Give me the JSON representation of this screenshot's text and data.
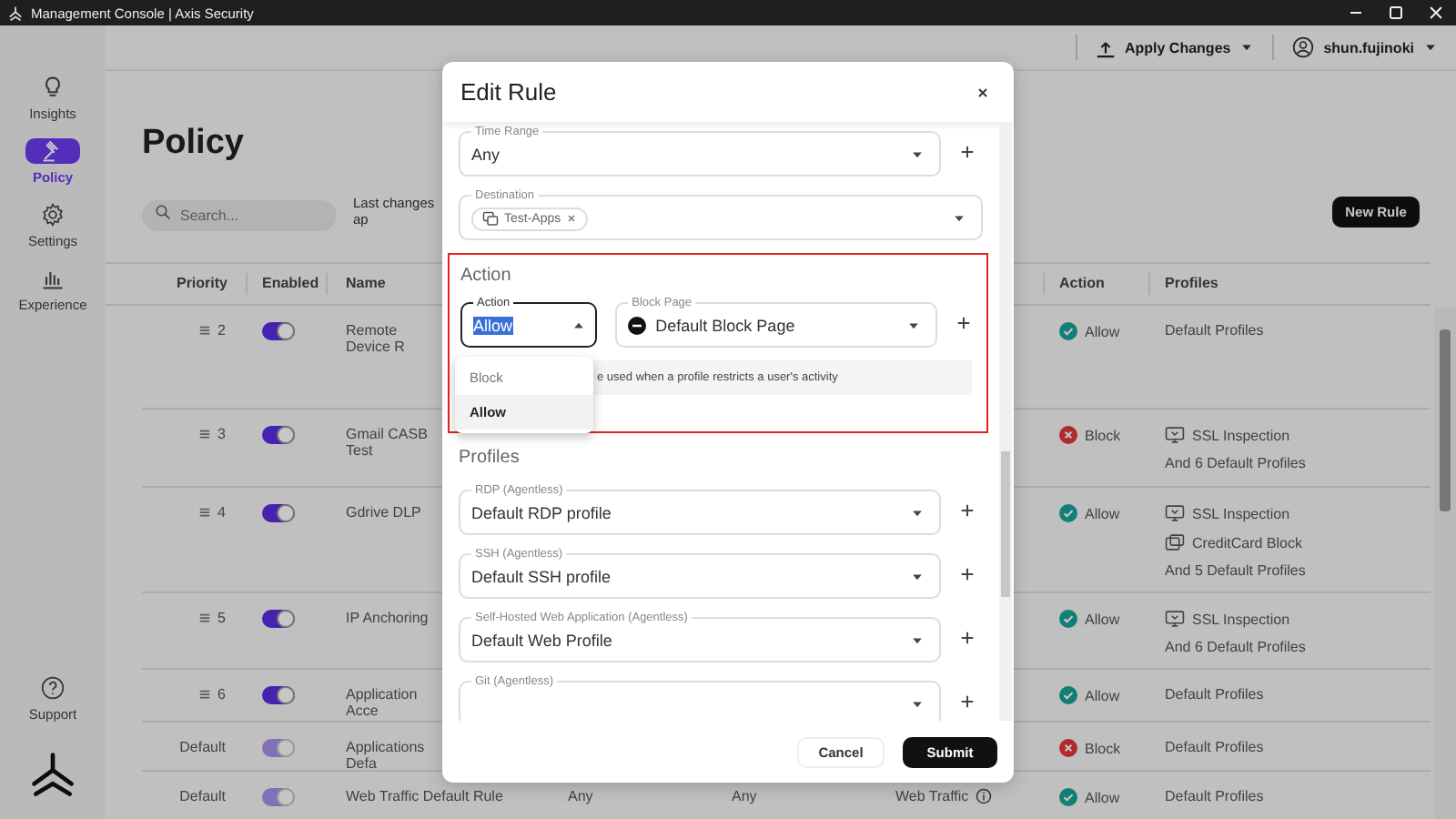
{
  "window": {
    "title": "Management Console | Axis Security"
  },
  "sidebar": {
    "items": [
      {
        "label": "Insights",
        "kind": "bulb",
        "selected": false
      },
      {
        "label": "Policy",
        "kind": "gavel",
        "selected": true
      },
      {
        "label": "Settings",
        "kind": "gear",
        "selected": false
      },
      {
        "label": "Experience",
        "kind": "chart",
        "selected": false
      }
    ],
    "support": "Support"
  },
  "topbar": {
    "apply_changes": "Apply Changes",
    "user": "shun.fujinoki"
  },
  "page": {
    "title": "Policy",
    "search": {
      "placeholder": "Search..."
    },
    "last_changes": "Last changes ap",
    "new_rule": "New Rule"
  },
  "table": {
    "columns": [
      "Priority",
      "Enabled",
      "Name",
      "Action",
      "Profiles"
    ],
    "rows": [
      {
        "priority": "2",
        "draggable": true,
        "enabled": {
          "on": true,
          "disabled": false
        },
        "name": "Remote Device R",
        "action": {
          "kind": "allow",
          "label": "Allow"
        },
        "profiles": [
          {
            "kind": "text",
            "label": "Default Profiles"
          }
        ]
      },
      {
        "priority": "3",
        "draggable": true,
        "enabled": {
          "on": true,
          "disabled": false
        },
        "name": "Gmail CASB Test",
        "action": {
          "kind": "block",
          "label": "Block"
        },
        "profiles": [
          {
            "kind": "ssl",
            "label": "SSL Inspection"
          },
          {
            "kind": "text",
            "label": "And 6 Default Profiles"
          }
        ]
      },
      {
        "priority": "4",
        "draggable": true,
        "enabled": {
          "on": true,
          "disabled": false
        },
        "name": "Gdrive DLP",
        "action": {
          "kind": "allow",
          "label": "Allow"
        },
        "profiles": [
          {
            "kind": "ssl",
            "label": "SSL Inspection"
          },
          {
            "kind": "dlp",
            "label": "CreditCard Block"
          },
          {
            "kind": "text",
            "label": "And 5 Default Profiles"
          }
        ]
      },
      {
        "priority": "5",
        "draggable": true,
        "enabled": {
          "on": true,
          "disabled": false
        },
        "name": "IP Anchoring",
        "action": {
          "kind": "allow",
          "label": "Allow"
        },
        "profiles": [
          {
            "kind": "ssl",
            "label": "SSL Inspection"
          },
          {
            "kind": "text",
            "label": "And 6 Default Profiles"
          }
        ]
      },
      {
        "priority": "6",
        "draggable": true,
        "enabled": {
          "on": true,
          "disabled": false
        },
        "name": "Application Acce",
        "action": {
          "kind": "allow",
          "label": "Allow"
        },
        "profiles": [
          {
            "kind": "text",
            "label": "Default Profiles"
          }
        ]
      },
      {
        "priority": "Default",
        "draggable": false,
        "enabled": {
          "on": true,
          "disabled": true
        },
        "name": "Applications Defa",
        "action": {
          "kind": "block",
          "label": "Block"
        },
        "profiles": [
          {
            "kind": "text",
            "label": "Default Profiles"
          }
        ]
      },
      {
        "priority": "Default",
        "draggable": false,
        "enabled": {
          "on": true,
          "disabled": true
        },
        "name": "Web Traffic Default Rule",
        "column_4": "Any",
        "column_5": "Any",
        "column_6": "Web Traffic",
        "action": {
          "kind": "allow",
          "label": "Allow"
        },
        "profiles": [
          {
            "kind": "text",
            "label": "Default Profiles"
          }
        ]
      }
    ]
  },
  "modal": {
    "title": "Edit Rule",
    "fields": [
      {
        "label": "Time Range",
        "value": "Any",
        "addable": true
      },
      {
        "label": "Destination",
        "chips": [
          "Test-Apps"
        ],
        "addable": false
      }
    ],
    "action_section": {
      "heading": "Action",
      "action_select": {
        "label": "Action",
        "value": "Allow",
        "open": true,
        "options": [
          {
            "label": "Block",
            "selected": false
          },
          {
            "label": "Allow",
            "selected": true
          }
        ]
      },
      "block_page": {
        "label": "Block Page",
        "value": "Default Block Page"
      },
      "note": "e used when a profile restricts a user's activity"
    },
    "profiles": {
      "heading": "Profiles",
      "fields": [
        {
          "label": "RDP (Agentless)",
          "value": "Default RDP profile"
        },
        {
          "label": "SSH (Agentless)",
          "value": "Default SSH profile"
        },
        {
          "label": "Self-Hosted Web Application (Agentless)",
          "value": "Default Web Profile"
        },
        {
          "label": "Git (Agentless)"
        }
      ]
    },
    "cancel": "Cancel",
    "submit": "Submit"
  }
}
